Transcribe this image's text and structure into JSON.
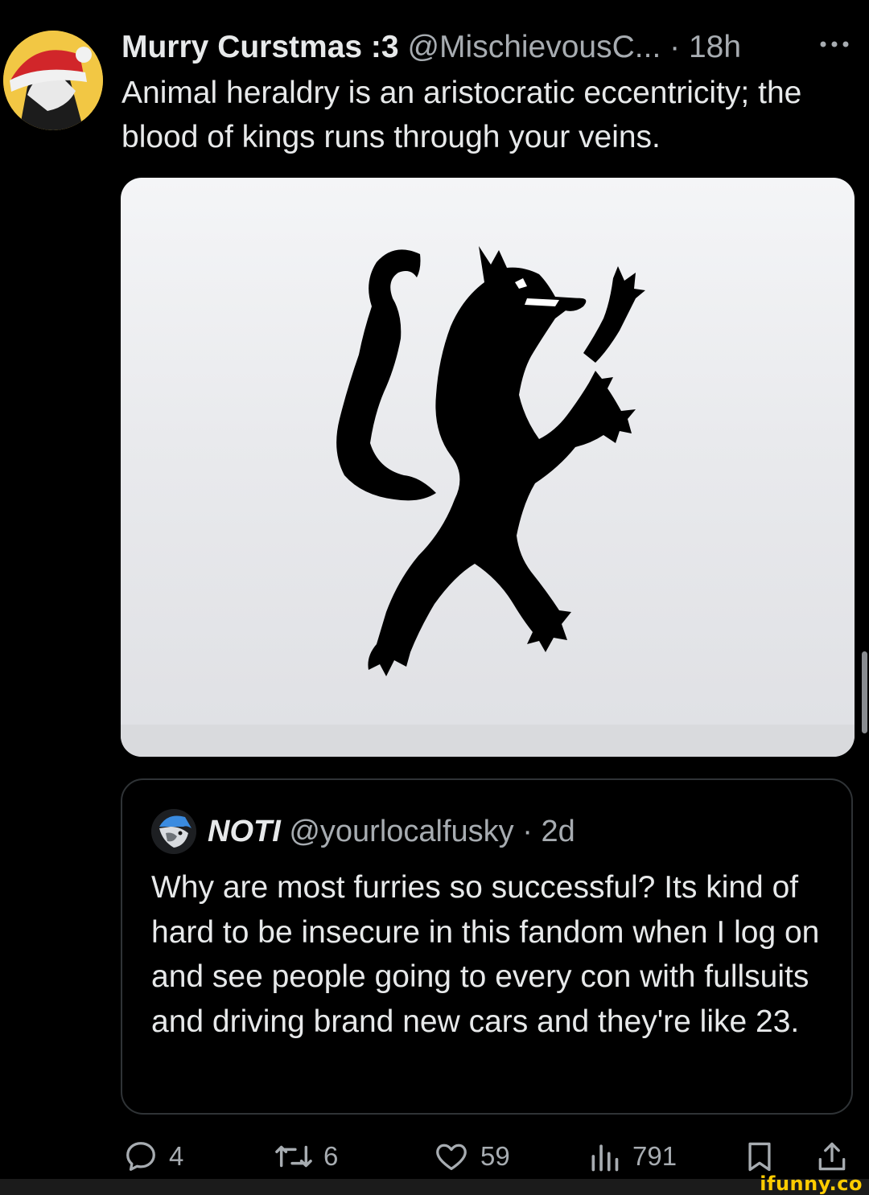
{
  "tweet": {
    "display_name": "Murry Curstmas :3",
    "handle": "@MischievousC...",
    "separator": "·",
    "time": "18h",
    "text": "Animal heraldry is an aristocratic eccentricity; the blood of kings runs through your veins.",
    "media_icon": "wolf-rampant-heraldry"
  },
  "quoted_tweet": {
    "display_name": "NOTI",
    "handle": "@yourlocalfusky",
    "separator": "·",
    "time": "2d",
    "text": "Why are most furries so successful? Its kind of hard to be insecure in this fandom when I log on and see people going to every con with fullsuits and driving brand new cars and they're like 23."
  },
  "actions": {
    "reply_count": "4",
    "retweet_count": "6",
    "like_count": "59",
    "views_count": "791"
  },
  "watermark": "ifunny.co",
  "colors": {
    "background": "#000000",
    "text_primary": "#e7e9ea",
    "text_secondary": "#a7acb1",
    "border": "#2f3336",
    "watermark": "#ffcc00"
  }
}
